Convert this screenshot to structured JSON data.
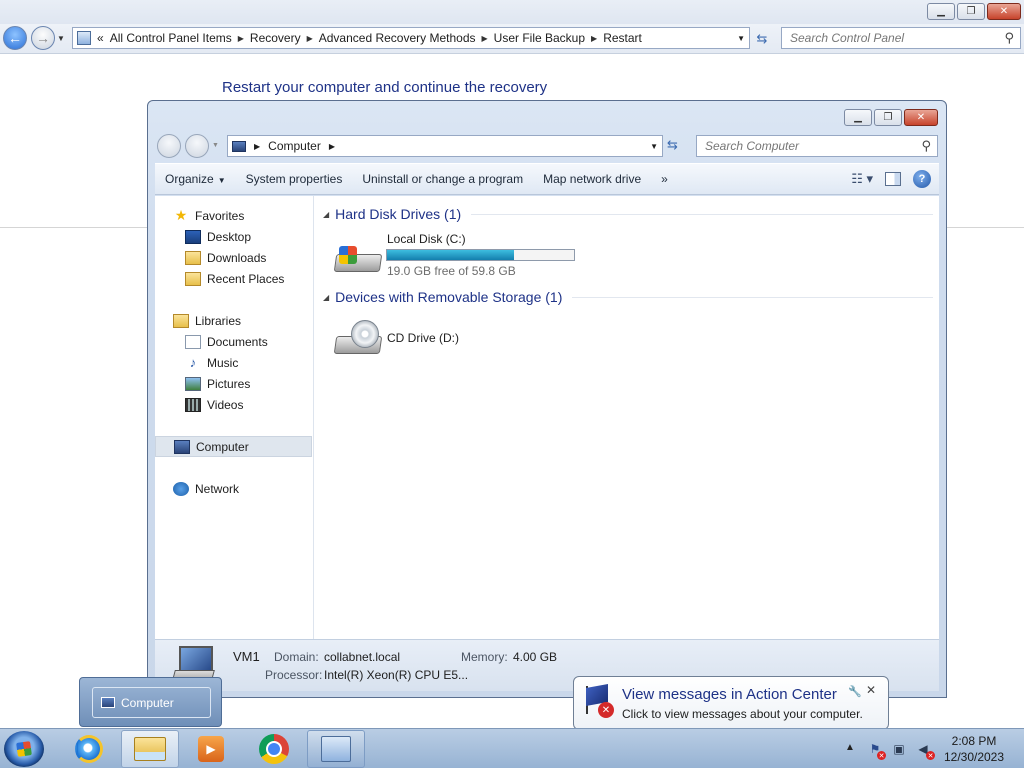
{
  "control_panel": {
    "breadcrumb": [
      "All Control Panel Items",
      "Recovery",
      "Advanced Recovery Methods",
      "User File Backup",
      "Restart"
    ],
    "breadcrumb_prefix": "«",
    "search_placeholder": "Search Control Panel",
    "heading": "Restart your computer and continue the recovery"
  },
  "computer_window": {
    "address": "Computer",
    "search_placeholder": "Search Computer",
    "toolbar": {
      "organize": "Organize",
      "system_properties": "System properties",
      "uninstall": "Uninstall or change a program",
      "map_drive": "Map network drive",
      "more": "»"
    },
    "nav": {
      "favorites": "Favorites",
      "desktop": "Desktop",
      "downloads": "Downloads",
      "recent_places": "Recent Places",
      "libraries": "Libraries",
      "documents": "Documents",
      "music": "Music",
      "pictures": "Pictures",
      "videos": "Videos",
      "computer": "Computer",
      "network": "Network"
    },
    "groups": {
      "hdd_title": "Hard Disk Drives (1)",
      "removable_title": "Devices with Removable Storage (1)"
    },
    "drives": {
      "c_name": "Local Disk (C:)",
      "c_free": "19.0 GB free of 59.8 GB",
      "c_used_fraction": 0.68,
      "d_name": "CD Drive (D:)"
    },
    "details": {
      "name": "VM1",
      "domain_label": "Domain:",
      "domain_value": "collabnet.local",
      "memory_label": "Memory:",
      "memory_value": "4.00 GB",
      "processor_label": "Processor:",
      "processor_value": "Intel(R) Xeon(R) CPU E5..."
    }
  },
  "taskbar": {
    "thumbnail_label": "Computer",
    "clock_time": "2:08 PM",
    "clock_date": "12/30/2023"
  },
  "balloon": {
    "title": "View messages in Action Center",
    "text": "Click to view messages about your computer."
  }
}
